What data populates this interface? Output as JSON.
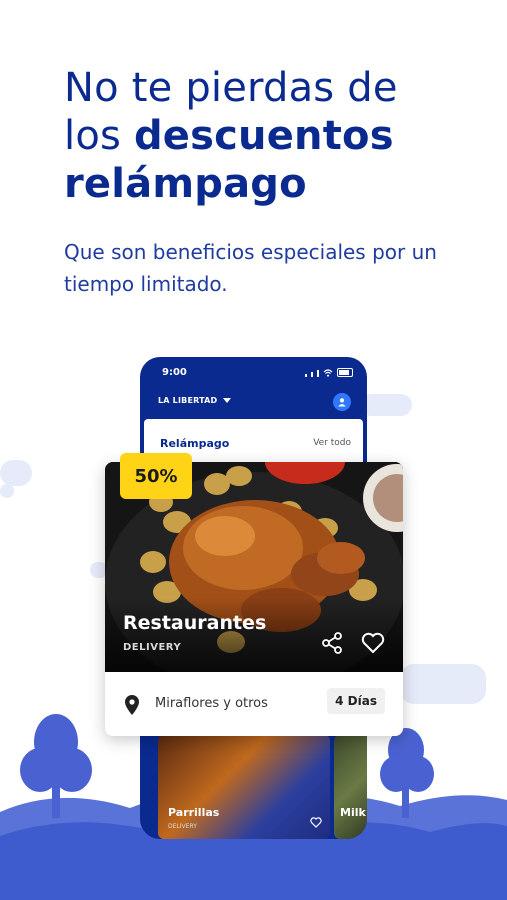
{
  "headline": {
    "line1": "No te pierdas de",
    "line2_prefix": "los ",
    "line2_bold": "descuentos",
    "line3_bold": "relámpago"
  },
  "subtitle": "Que son beneficios especiales por un tiempo limitado.",
  "phone": {
    "time": "9:00",
    "location": "LA LIBERTAD",
    "section_title": "Relámpago",
    "see_all": "Ver todo",
    "bottom_cards": [
      {
        "label": "Parrillas",
        "sub": "DELIVERY"
      },
      {
        "label": "Milk",
        "sub": ""
      }
    ]
  },
  "card": {
    "badge": "50%",
    "title": "Restaurantes",
    "subtitle": "DELIVERY",
    "location": "Miraflores y otros",
    "days": "4 Días"
  },
  "colors": {
    "brand_blue": "#0a2a8f",
    "badge_yellow": "#ffd417",
    "light_blue": "#5a73d8"
  }
}
